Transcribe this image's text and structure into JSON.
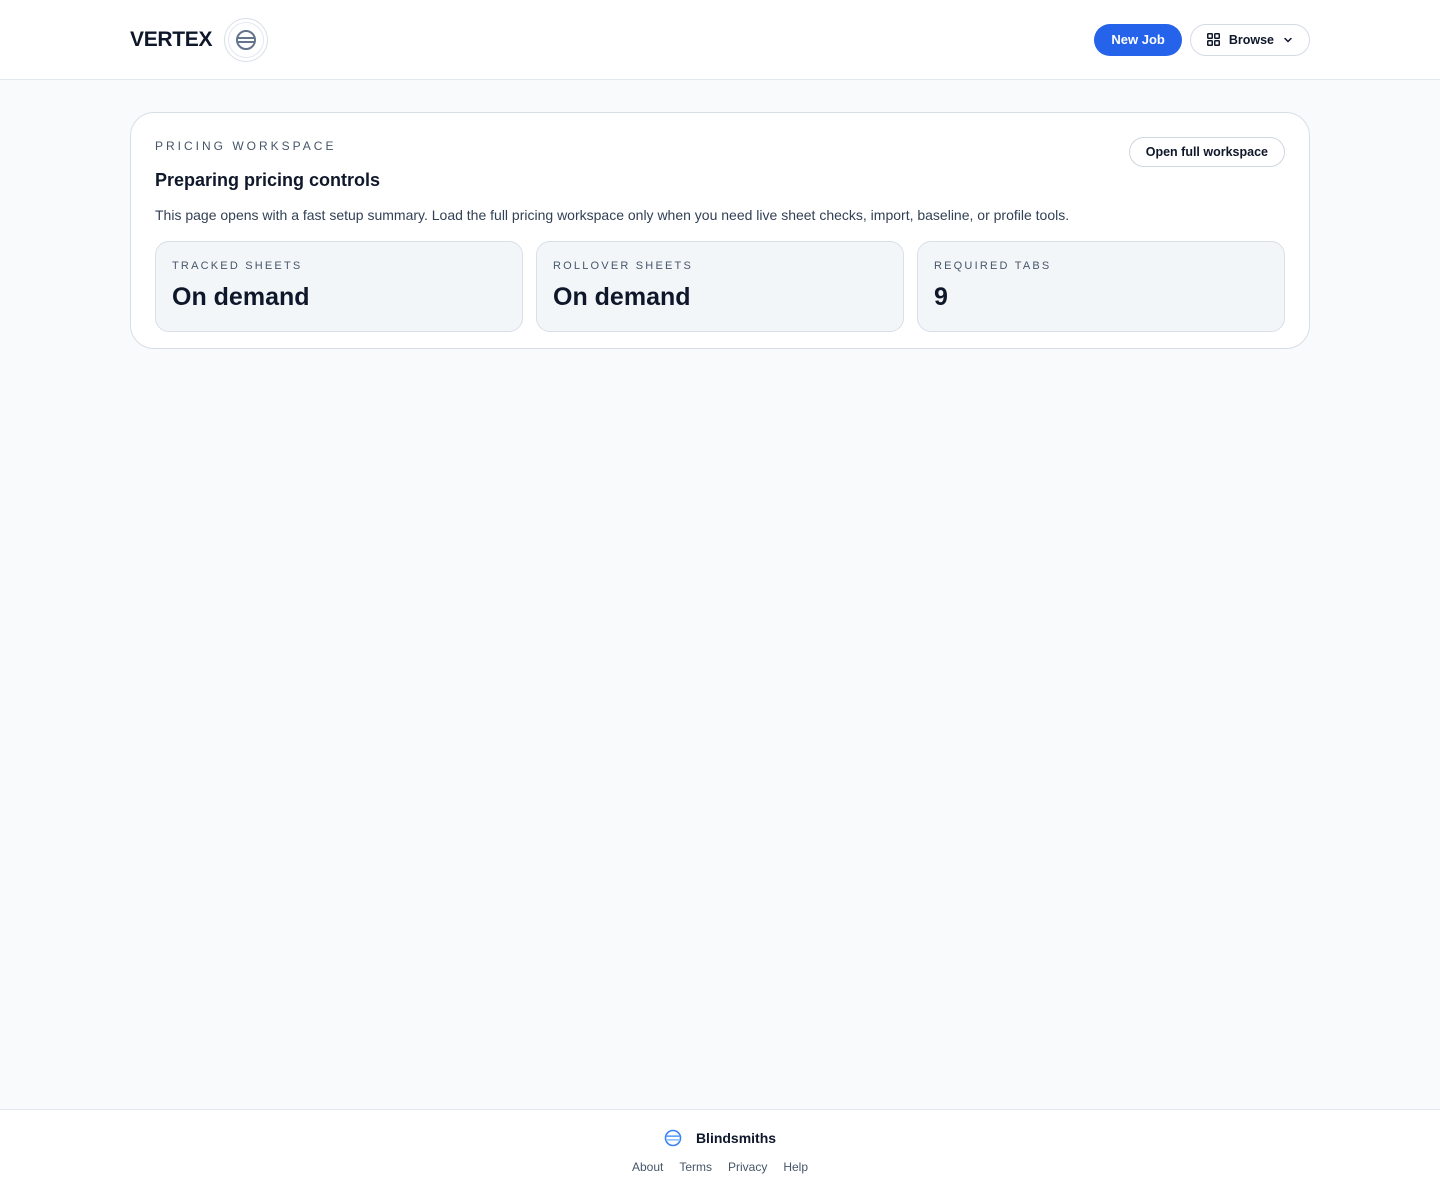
{
  "header": {
    "brand_name": "VERTEX",
    "logo_icon": "vertex-logo-icon",
    "new_job_label": "New Job",
    "browse_label": "Browse",
    "browse_icon": "grid-icon",
    "browse_chevron": "chevron-down-icon"
  },
  "workspace": {
    "eyebrow": "PRICING WORKSPACE",
    "title": "Preparing pricing controls",
    "description": "This page opens with a fast setup summary. Load the full pricing workspace only when you need live sheet checks, import, baseline, or profile tools.",
    "open_button_label": "Open full workspace",
    "stats": [
      {
        "label": "TRACKED SHEETS",
        "value": "On demand"
      },
      {
        "label": "ROLLOVER SHEETS",
        "value": "On demand"
      },
      {
        "label": "REQUIRED TABS",
        "value": "9"
      }
    ]
  },
  "footer": {
    "brand_name": "Blindsmiths",
    "logo_icon": "blindsmiths-logo-icon",
    "links": [
      "About",
      "Terms",
      "Privacy",
      "Help"
    ]
  },
  "colors": {
    "accent": "#2563eb",
    "page_background": "#f8fafc",
    "card_border": "#d7dee7",
    "text_primary": "#0f172a",
    "text_muted": "#475569"
  }
}
